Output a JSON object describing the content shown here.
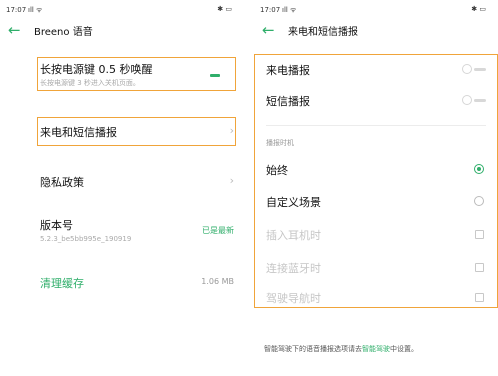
{
  "colors": {
    "accent": "#2fae6a",
    "highlight": "#f0a43a",
    "disabled_text": "#c6c6c6"
  },
  "left_screen": {
    "status_bar": {
      "time": "17:07",
      "signal_icon": "signal-wifi-icons",
      "battery": "79"
    },
    "header": {
      "back_icon": "back-arrow-icon",
      "title": "Breeno 语音"
    },
    "power_key": {
      "title": "长按电源键 0.5 秒唤醒",
      "subtitle": "长按电源键 3 秒进入关机页面。"
    },
    "call_sms": {
      "title": "来电和短信播报",
      "chevron": "›"
    },
    "privacy": {
      "title": "隐私政策",
      "chevron": "›"
    },
    "version": {
      "title": "版本号",
      "number": "5.2.3_be5bb995e_190919",
      "status": "已是最新"
    },
    "cache": {
      "title": "清理缓存",
      "size": "1.06 MB"
    }
  },
  "right_screen": {
    "status_bar": {
      "time": "17:07",
      "signal_icon": "signal-wifi-icons",
      "battery": "79"
    },
    "header": {
      "back_icon": "back-arrow-icon",
      "title": "来电和短信播报"
    },
    "calls": {
      "title": "来电播报",
      "enabled": false
    },
    "sms": {
      "title": "短信播报",
      "enabled": false
    },
    "section_title": "播报时机",
    "timing_options": [
      {
        "label": "始终",
        "control": "radio",
        "selected": true,
        "disabled": false
      },
      {
        "label": "自定义场景",
        "control": "radio",
        "selected": false,
        "disabled": false
      },
      {
        "label": "插入耳机时",
        "control": "checkbox",
        "checked": false,
        "disabled": true
      },
      {
        "label": "连接蓝牙时",
        "control": "checkbox",
        "checked": false,
        "disabled": true
      },
      {
        "label": "驾驶导航时",
        "control": "checkbox",
        "checked": false,
        "disabled": true
      }
    ],
    "footnote": {
      "before": "智能驾驶下的语音播报选项请去",
      "link": "智能驾驶",
      "after": "中设置。"
    }
  }
}
